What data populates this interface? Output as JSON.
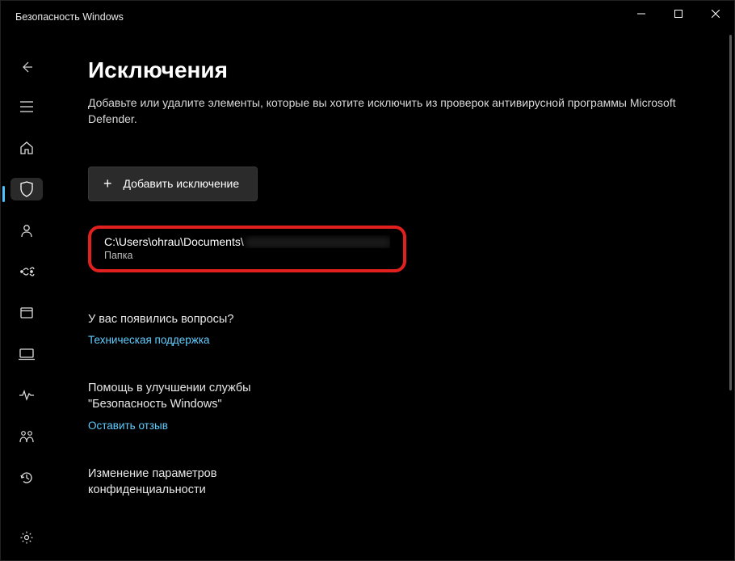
{
  "window": {
    "title": "Безопасность Windows"
  },
  "page": {
    "title": "Исключения",
    "description": "Добавьте или удалите элементы, которые вы хотите исключить из проверок антивирусной программы Microsoft Defender."
  },
  "add_button": {
    "label": "Добавить исключение"
  },
  "exclusion": {
    "path_visible": "C:\\Users\\ohrau\\Documents\\",
    "type": "Папка"
  },
  "sections": {
    "help": {
      "title": "У вас появились вопросы?",
      "link": "Техническая поддержка"
    },
    "improve": {
      "title": "Помощь в улучшении службы \"Безопасность Windows\"",
      "link": "Оставить отзыв"
    },
    "privacy": {
      "title": "Изменение параметров конфиденциальности"
    }
  },
  "sidebar": {
    "items": [
      {
        "name": "back"
      },
      {
        "name": "menu"
      },
      {
        "name": "home"
      },
      {
        "name": "shield",
        "active": true
      },
      {
        "name": "account"
      },
      {
        "name": "firewall"
      },
      {
        "name": "app-control"
      },
      {
        "name": "device"
      },
      {
        "name": "performance"
      },
      {
        "name": "family"
      },
      {
        "name": "history"
      }
    ],
    "footer": {
      "name": "settings"
    }
  }
}
